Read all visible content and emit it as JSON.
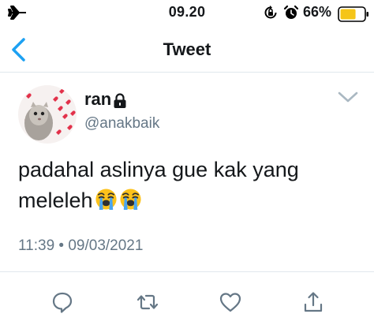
{
  "status_bar": {
    "time": "09.20",
    "battery_percent": "66%",
    "icons": [
      "airplane-mode-icon",
      "rotation-lock-icon",
      "alarm-icon",
      "battery-icon"
    ],
    "battery_level": 0.66,
    "battery_color": "#f5c518"
  },
  "nav": {
    "back_icon": "chevron-left-icon",
    "title": "Tweet",
    "accent_color": "#1da1f2"
  },
  "tweet": {
    "display_name": "ran",
    "protected_icon": "lock-icon",
    "handle": "@anakbaik",
    "text": "padahal aslinya gue kak yang meleleh",
    "emojis": [
      "loudly-crying-face",
      "loudly-crying-face"
    ],
    "timestamp": "11:39 • 09/03/2021",
    "menu_icon": "chevron-down-icon"
  },
  "actions": [
    {
      "name": "reply",
      "icon": "reply-icon"
    },
    {
      "name": "retweet",
      "icon": "retweet-icon"
    },
    {
      "name": "like",
      "icon": "heart-icon"
    },
    {
      "name": "share",
      "icon": "share-icon"
    }
  ]
}
